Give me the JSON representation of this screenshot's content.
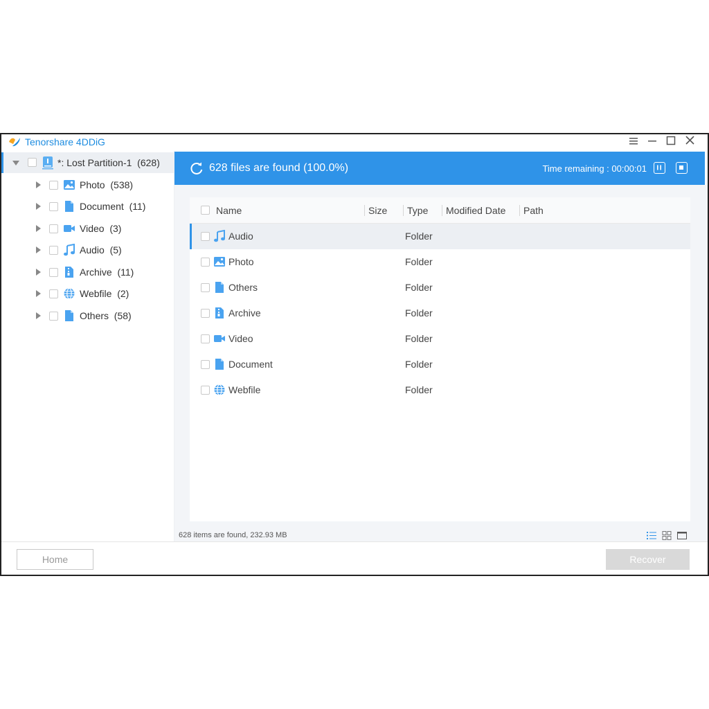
{
  "app": {
    "title": "Tenorshare 4DDiG"
  },
  "colors": {
    "accent": "#2f93e8",
    "icon_blue": "#4aa3f0",
    "disabled": "#d9d9d9"
  },
  "sidebar": {
    "root": {
      "label": "*: Lost Partition-1",
      "count": "(628)",
      "icon": "drive-icon"
    },
    "items": [
      {
        "label": "Photo",
        "count": "(538)",
        "icon": "photo-icon"
      },
      {
        "label": "Document",
        "count": "(11)",
        "icon": "document-icon"
      },
      {
        "label": "Video",
        "count": "(3)",
        "icon": "video-icon"
      },
      {
        "label": "Audio",
        "count": "(5)",
        "icon": "audio-icon"
      },
      {
        "label": "Archive",
        "count": "(11)",
        "icon": "archive-icon"
      },
      {
        "label": "Webfile",
        "count": "(2)",
        "icon": "globe-icon"
      },
      {
        "label": "Others",
        "count": "(58)",
        "icon": "file-icon"
      }
    ]
  },
  "scan": {
    "found_text": "628 files are found (100.0%)",
    "time_label": "Time remaining : 00:00:01",
    "progress_percent": 100
  },
  "table": {
    "columns": [
      "Name",
      "Size",
      "Type",
      "Modified Date",
      "Path"
    ],
    "rows": [
      {
        "name": "Audio",
        "type": "Folder",
        "icon": "audio-icon",
        "selected": true
      },
      {
        "name": "Photo",
        "type": "Folder",
        "icon": "photo-icon"
      },
      {
        "name": "Others",
        "type": "Folder",
        "icon": "file-icon"
      },
      {
        "name": "Archive",
        "type": "Folder",
        "icon": "archive-icon"
      },
      {
        "name": "Video",
        "type": "Folder",
        "icon": "video-icon"
      },
      {
        "name": "Document",
        "type": "Folder",
        "icon": "document-icon"
      },
      {
        "name": "Webfile",
        "type": "Folder",
        "icon": "globe-icon"
      }
    ]
  },
  "status": {
    "text": "628 items are found, 232.93 MB"
  },
  "footer": {
    "home_label": "Home",
    "recover_label": "Recover"
  }
}
